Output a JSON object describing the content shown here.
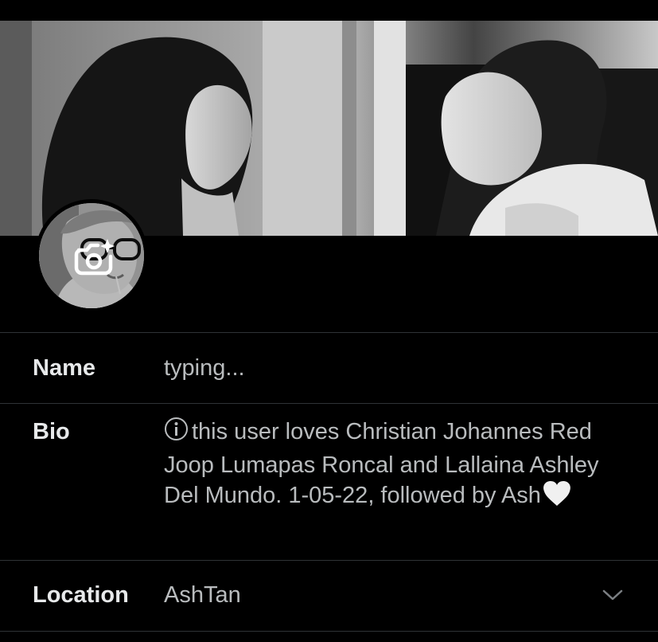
{
  "profile": {
    "banner_icon": "photo-banner",
    "avatar_icon": "profile-photo",
    "camera_icon": "camera-sparkle-icon"
  },
  "fields": {
    "name": {
      "label": "Name",
      "value": "typing..."
    },
    "bio": {
      "label": "Bio",
      "info_icon": "info-icon",
      "value": "this user loves Christian Johannes Red Joop Lumapas Roncal and Lallaina Ashley Del Mundo. 1-05-22, followed by Ash",
      "heart_icon": "white-heart-icon"
    },
    "location": {
      "label": "Location",
      "value": "AshTan",
      "chevron_icon": "chevron-down-icon"
    }
  },
  "colors": {
    "background": "#000000",
    "text": "#e7e9ea",
    "muted_text": "#b9bcbe",
    "divider": "#2f3336"
  }
}
